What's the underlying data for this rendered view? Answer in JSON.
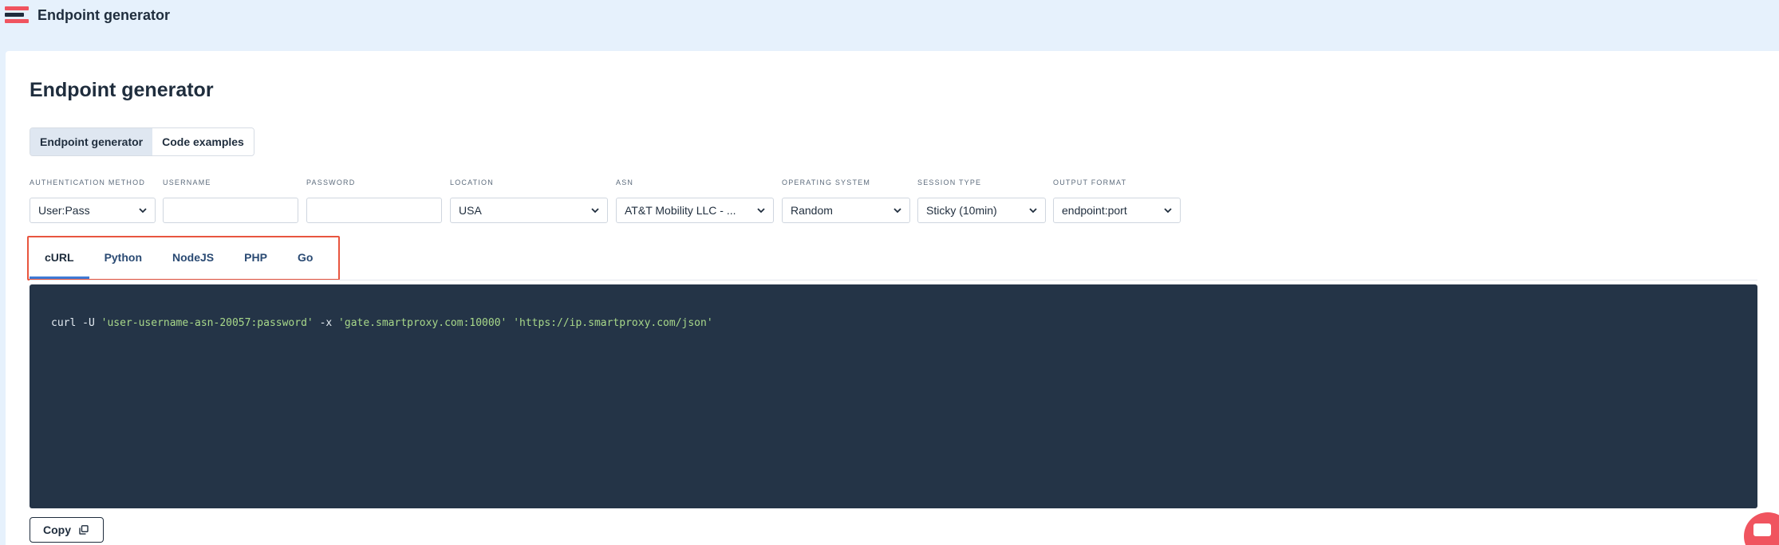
{
  "header": {
    "app_title": "Endpoint generator",
    "menu_icon": "hamburger-logo-icon",
    "brand_colors": {
      "primary": "#f0545f",
      "dark": "#1f2d3d"
    }
  },
  "main": {
    "title": "Endpoint generator",
    "mode_tabs": [
      {
        "label": "Endpoint generator",
        "active": true
      },
      {
        "label": "Code examples",
        "active": false
      }
    ],
    "fields": {
      "auth_method": {
        "label": "AUTHENTICATION METHOD",
        "value": "User:Pass"
      },
      "username": {
        "label": "USERNAME",
        "value": "",
        "placeholder": ""
      },
      "password": {
        "label": "PASSWORD",
        "value": "",
        "placeholder": ""
      },
      "location": {
        "label": "LOCATION",
        "value": "USA"
      },
      "asn": {
        "label": "ASN",
        "value": "AT&T Mobility LLC - ..."
      },
      "os": {
        "label": "OPERATING SYSTEM",
        "value": "Random"
      },
      "session_type": {
        "label": "SESSION TYPE",
        "value": "Sticky (10min)"
      },
      "output_format": {
        "label": "OUTPUT FORMAT",
        "value": "endpoint:port"
      }
    },
    "language_tabs": [
      {
        "label": "cURL",
        "active": true
      },
      {
        "label": "Python",
        "active": false
      },
      {
        "label": "NodeJS",
        "active": false
      },
      {
        "label": "PHP",
        "active": false
      },
      {
        "label": "Go",
        "active": false
      }
    ],
    "code": {
      "cmd": "curl",
      "flag_user": "-U",
      "credentials": "'user-username-asn-20057:password'",
      "flag_proxy": "-x",
      "proxy": "'gate.smartproxy.com:10000'",
      "url": "'https://ip.smartproxy.com/json'",
      "background": "#243447",
      "string_color": "#a8d88a"
    },
    "copy_button": {
      "label": "Copy",
      "icon": "copy-icon"
    },
    "highlight_color": "#e8553f"
  },
  "chat": {
    "icon": "chat-icon",
    "color": "#f0545f"
  }
}
